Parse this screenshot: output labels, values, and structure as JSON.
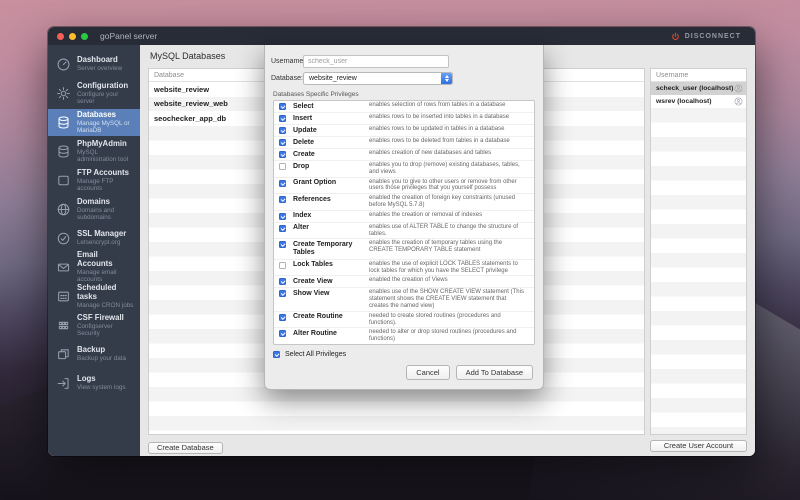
{
  "window": {
    "title": "goPanel server",
    "disconnect_label": "DISCONNECT"
  },
  "colors": {
    "sidebar_selected_blue": "#5b80b9",
    "checkbox_blue": "#3c78e7",
    "disconnect_orange": "#cf4b2b",
    "sidebar_bg": "#343b49",
    "titlebar_bg": "#272c37"
  },
  "sidebar": {
    "items": [
      {
        "label": "Dashboard",
        "sublabel": "Server overview",
        "icon": "gauge-icon",
        "selected": false
      },
      {
        "label": "Configuration",
        "sublabel": "Configure your server",
        "icon": "gear-icon",
        "selected": false
      },
      {
        "label": "Databases",
        "sublabel": "Manage MySQL or MariaDB",
        "icon": "database-icon",
        "selected": true
      },
      {
        "label": "PhpMyAdmin",
        "sublabel": "MySQL administration tool",
        "icon": "database-icon",
        "selected": false
      },
      {
        "label": "FTP Accounts",
        "sublabel": "Manage FTP accounts",
        "icon": "folder-icon",
        "selected": false
      },
      {
        "label": "Domains",
        "sublabel": "Domains and subdomains",
        "icon": "globe-icon",
        "selected": false
      },
      {
        "label": "SSL Manager",
        "sublabel": "Letsencrypt.org",
        "icon": "check-circle-icon",
        "selected": false
      },
      {
        "label": "Email Accounts",
        "sublabel": "Manage email accounts",
        "icon": "envelope-icon",
        "selected": false
      },
      {
        "label": "Scheduled tasks",
        "sublabel": "Manage CRON jobs",
        "icon": "calendar-icon",
        "selected": false
      },
      {
        "label": "CSF Firewall",
        "sublabel": "Configserver Security",
        "icon": "bricks-icon",
        "selected": false
      },
      {
        "label": "Backup",
        "sublabel": "Backup your data",
        "icon": "copy-icon",
        "selected": false
      },
      {
        "label": "Logs",
        "sublabel": "View system logs",
        "icon": "export-icon",
        "selected": false
      }
    ]
  },
  "content": {
    "databases_panel": {
      "title": "MySQL Databases",
      "column_header": "Database",
      "rows": [
        "website_review",
        "website_review_web",
        "seochecker_app_db"
      ],
      "create_button": "Create Database"
    },
    "users_panel": {
      "column_header": "Username",
      "rows": [
        {
          "name": "scheck_user (localhost)",
          "selected": true
        },
        {
          "name": "wsrev (localhost)",
          "selected": false
        }
      ],
      "create_button": "Create User Account"
    }
  },
  "modal": {
    "username_label": "Username:",
    "username_placeholder": "scheck_user",
    "database_label": "Database:",
    "database_value": "website_review",
    "privileges_label": "Databases Specific Privileges",
    "privileges": [
      {
        "name": "Select",
        "desc": "enables selection of rows from tables in a database",
        "checked": true
      },
      {
        "name": "Insert",
        "desc": "enables rows to be inserted into tables in a database",
        "checked": true
      },
      {
        "name": "Update",
        "desc": "enables rows to be updated in tables in a database",
        "checked": true
      },
      {
        "name": "Delete",
        "desc": "enables rows to be deleted from tables in a database",
        "checked": true
      },
      {
        "name": "Create",
        "desc": "enables creation of new databases and tables",
        "checked": true
      },
      {
        "name": "Drop",
        "desc": "enables you to drop (remove) existing databases, tables, and views",
        "checked": false
      },
      {
        "name": "Grant Option",
        "desc": "enables you to give to other users or remove from other users those privileges that you yourself possess",
        "checked": true
      },
      {
        "name": "References",
        "desc": "enabled the creation of foreign key constraints (unused before MySQL 5.7.8)",
        "checked": true
      },
      {
        "name": "Index",
        "desc": "enables the creation or removal of indexes",
        "checked": true
      },
      {
        "name": "Alter",
        "desc": "enables use of ALTER TABLE to change the structure of tables.",
        "checked": true
      },
      {
        "name": "Create Temporary Tables",
        "desc": "enables the creation of temporary tables using the CREATE TEMPORARY TABLE statement",
        "checked": true
      },
      {
        "name": "Lock Tables",
        "desc": "enables the use of explicit LOCK TABLES statements to lock tables for which you have the SELECT privilege",
        "checked": false
      },
      {
        "name": "Create View",
        "desc": "enabled the creation of Views",
        "checked": true
      },
      {
        "name": "Show View",
        "desc": "enables use of the SHOW CREATE VIEW statement (This statement shows the CREATE VIEW statement that creates the named view)",
        "checked": true
      },
      {
        "name": "Create Routine",
        "desc": "needed to create stored routines (procedures and functions).",
        "checked": true
      },
      {
        "name": "Alter Routine",
        "desc": "needed to alter or drop stored routines (procedures and functions)",
        "checked": true
      }
    ],
    "select_all_label": "Select All Privileges",
    "select_all_checked": true,
    "cancel_label": "Cancel",
    "submit_label": "Add To Database"
  }
}
